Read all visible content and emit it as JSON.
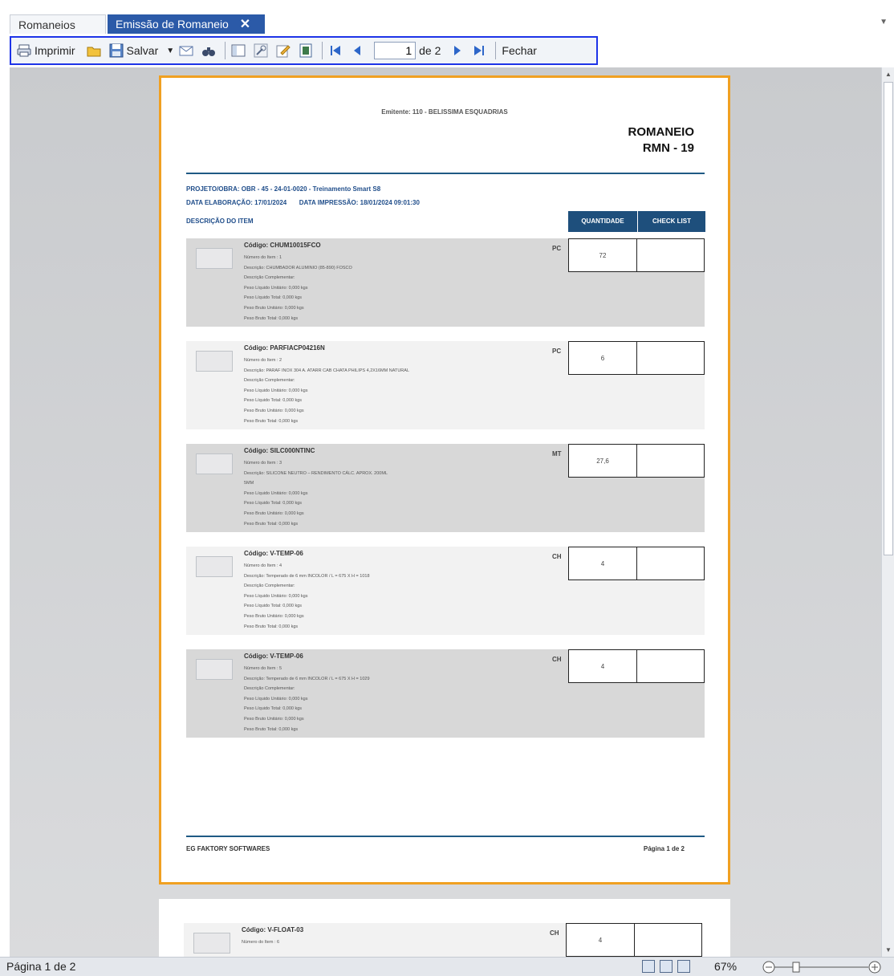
{
  "tabs": [
    {
      "label": "Romaneios"
    },
    {
      "label": "Emissão de Romaneio",
      "close": "✕"
    }
  ],
  "toolbar": {
    "print_label": "Imprimir",
    "save_label": "Salvar",
    "page_current": "1",
    "page_of": "de 2",
    "close_label": "Fechar"
  },
  "document": {
    "emitente": "Emitente: 110 - BELISSIMA ESQUADRIAS",
    "title": "ROMANEIO",
    "number": "RMN - 19",
    "projeto": "PROJETO/OBRA: OBR - 45 - 24-01-0020 - Treinamento Smart S8",
    "data_elab": "DATA ELABORAÇÃO: 17/01/2024",
    "data_impr": "DATA IMPRESSÃO: 18/01/2024 09:01:30",
    "desc_header": "DESCRIÇÃO DO ITEM",
    "qty_header": "QUANTIDADE",
    "check_header": "CHECK LIST",
    "footer_left": "EG FAKTORY SOFTWARES",
    "footer_right": "Página 1 de 2"
  },
  "items": [
    {
      "code": "Código: CHUM10015FCO",
      "unit": "PC",
      "qty": "72",
      "lines": [
        "Número do Item : 1",
        "Descrição: CHUMBADOR ALUMINIO (85-890) FOSCO",
        "Descrição Complementar:",
        "Peso Líquido Unitário: 0,000 kgs",
        "Peso Líquido Total: 0,000 kgs",
        "Peso Bruto Unitário: 0,000 kgs",
        "Peso Bruto Total: 0,000 kgs"
      ]
    },
    {
      "code": "Código: PARFIACP04216N",
      "unit": "PC",
      "qty": "6",
      "lines": [
        "Número do Item : 2",
        "Descrição: PARAF INOX 304 A. ATARR CAB CHATA PHILIPS 4,2X16MM NATURAL",
        "Descrição Complementar:",
        "Peso Líquido Unitário: 0,000 kgs",
        "Peso Líquido Total: 0,000 kgs",
        "Peso Bruto Unitário: 0,000 kgs",
        "Peso Bruto Total: 0,000 kgs"
      ]
    },
    {
      "code": "Código: SILC000NTINC",
      "unit": "MT",
      "qty": "27,6",
      "lines": [
        "Número do Item : 3",
        "Descrição: SILICONE NEUTRO – RENDIMENTO CÁLC. APROX. 200ML",
        "5MM",
        "Peso Líquido Unitário: 0,000 kgs",
        "Peso Líquido Total: 0,000 kgs",
        "Peso Bruto Unitário: 0,000 kgs",
        "Peso Bruto Total: 0,000 kgs"
      ]
    },
    {
      "code": "Código: V-TEMP-06",
      "unit": "CH",
      "qty": "4",
      "lines": [
        "Número do Item : 4",
        "Descrição: Temperado de 6 mm INCOLOR / L = 675 X H = 1018",
        "Descrição Complementar:",
        "Peso Líquido Unitário: 0,000 kgs",
        "Peso Líquido Total: 0,000 kgs",
        "Peso Bruto Unitário: 0,000 kgs",
        "Peso Bruto Total: 0,000 kgs"
      ]
    },
    {
      "code": "Código: V-TEMP-06",
      "unit": "CH",
      "qty": "4",
      "lines": [
        "Número do Item : 5",
        "Descrição: Temperado de 6 mm INCOLOR / L = 675 X H = 1029",
        "Descrição Complementar:",
        "Peso Líquido Unitário: 0,000 kgs",
        "Peso Líquido Total: 0,000 kgs",
        "Peso Bruto Unitário: 0,000 kgs",
        "Peso Bruto Total: 0,000 kgs"
      ]
    }
  ],
  "page2_item": {
    "code": "Código: V-FLOAT-03",
    "unit": "CH",
    "qty": "4",
    "line": "Número do Item : 6"
  },
  "status": {
    "page_text": "Página 1 de 2",
    "zoom": "67%"
  }
}
